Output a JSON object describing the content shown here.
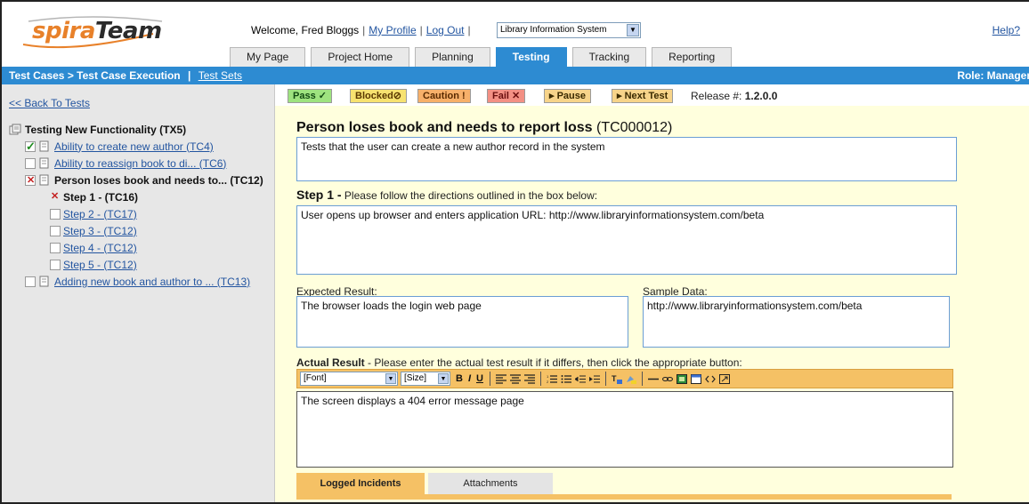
{
  "header": {
    "logo": {
      "spira": "spira",
      "team": "Team"
    },
    "welcome_prefix": "Welcome, Fred Bloggs",
    "my_profile": "My Profile",
    "log_out": "Log Out",
    "project_select": "Library Information System",
    "help": "Help?"
  },
  "tabs": [
    {
      "label": "My Page",
      "active": false
    },
    {
      "label": "Project Home",
      "active": false
    },
    {
      "label": "Planning",
      "active": false
    },
    {
      "label": "Testing",
      "active": true
    },
    {
      "label": "Tracking",
      "active": false
    },
    {
      "label": "Reporting",
      "active": false
    }
  ],
  "bluebar": {
    "breadcrumb": "Test Cases > Test Case Execution",
    "sep": "|",
    "test_sets": "Test Sets",
    "role": "Role: Manager"
  },
  "sidebar": {
    "back_link": "<< Back To Tests",
    "tree": [
      {
        "label": "Testing New Functionality (TX5)",
        "status": "folder",
        "level": 1,
        "style": "bold"
      },
      {
        "label": "Ability to create new author (TC4)",
        "status": "pass",
        "level": 1,
        "style": "link"
      },
      {
        "label": "Ability to reassign book to di... (TC6)",
        "status": "none",
        "level": 1,
        "style": "link"
      },
      {
        "label": "Person loses book and needs to... (TC12)",
        "status": "fail",
        "level": 1,
        "style": "bold"
      },
      {
        "label": "Step 1 - (TC16)",
        "status": "fail",
        "level": 2,
        "style": "bold"
      },
      {
        "label": "Step 2 - (TC17)",
        "status": "none",
        "level": 2,
        "style": "link"
      },
      {
        "label": "Step 3 - (TC12)",
        "status": "none",
        "level": 2,
        "style": "link"
      },
      {
        "label": "Step 4 - (TC12)",
        "status": "none",
        "level": 2,
        "style": "link"
      },
      {
        "label": "Step 5 - (TC12)",
        "status": "none",
        "level": 2,
        "style": "link"
      },
      {
        "label": "Adding new book and author to ... (TC13)",
        "status": "none",
        "level": 1,
        "style": "link"
      }
    ]
  },
  "actions": {
    "pass": "Pass ✓",
    "blocked": "Blocked⊘",
    "caution": "Caution !",
    "fail": "Fail ✕",
    "pause": "▸ Pause",
    "next": "▸ Next Test",
    "release_label": "Release #:",
    "release_value": "1.2.0.0"
  },
  "main": {
    "title": "Person loses book and needs to report loss",
    "title_id": "(TC000012)",
    "description": "Tests that the user can create a new author record in the system",
    "step_heading": "Step 1 -",
    "step_instructions": "Please follow the directions outlined in the box below:",
    "step_text": "User opens up browser and enters application URL: http://www.libraryinformationsystem.com/beta",
    "expected_label": "Expected Result:",
    "expected_text": "The browser loads the login web page",
    "sample_label": "Sample Data:",
    "sample_text": "http://www.libraryinformationsystem.com/beta",
    "actual_heading": "Actual Result",
    "actual_instructions": "- Please enter the actual test result if it differs, then click the appropriate button:",
    "actual_text": "The screen displays a 404 error message page"
  },
  "editor": {
    "font": "[Font]",
    "size": "[Size]",
    "bold": "B",
    "italic": "I",
    "underline": "U"
  },
  "bottom_tabs": {
    "logged_incidents": "Logged Incidents",
    "attachments": "Attachments"
  },
  "colors": {
    "accent_blue": "#2d8bd2",
    "logo_orange": "#e8812a",
    "content_bg": "#ffffdd",
    "toolbar_orange": "#f5c165"
  }
}
